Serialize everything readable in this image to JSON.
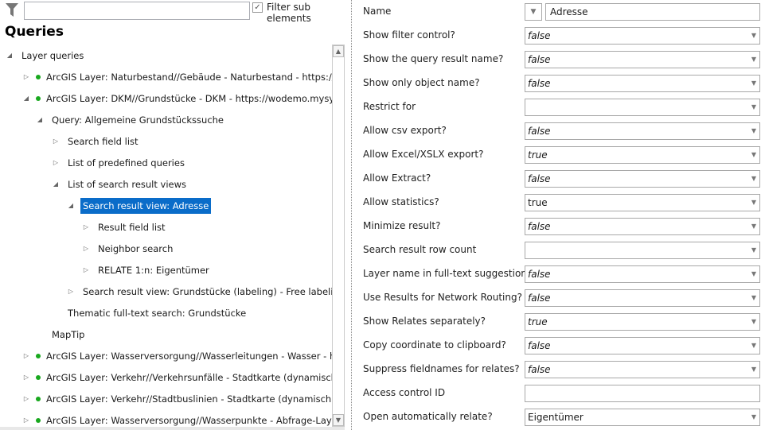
{
  "filter": {
    "placeholder": "",
    "checkbox_label": "Filter sub elements",
    "checked": true
  },
  "title": "Queries",
  "tree": [
    {
      "level": 0,
      "label": "Layer queries",
      "arrow": "expanded",
      "dot": false
    },
    {
      "level": 1,
      "label": "ArcGIS Layer: Naturbestand//Gebäude - Naturbestand - https://wodemo",
      "arrow": "collapsed",
      "dot": true
    },
    {
      "level": 1,
      "label": "ArcGIS Layer: DKM//Grundstücke - DKM - https://wodemo.mysynergis.c",
      "arrow": "expanded",
      "dot": true
    },
    {
      "level": 2,
      "label": "Query: Allgemeine Grundstückssuche",
      "arrow": "expanded",
      "dot": false
    },
    {
      "level": 3,
      "label": "Search field list",
      "arrow": "collapsed",
      "dot": false
    },
    {
      "level": 3,
      "label": "List of predefined queries",
      "arrow": "collapsed",
      "dot": false
    },
    {
      "level": 3,
      "label": "List of search result views",
      "arrow": "expanded",
      "dot": false
    },
    {
      "level": 4,
      "label": "Search result view: Adresse",
      "arrow": "expanded",
      "dot": false,
      "selected": true
    },
    {
      "level": 5,
      "label": "Result field list",
      "arrow": "collapsed",
      "dot": false
    },
    {
      "level": 5,
      "label": "Neighbor search",
      "arrow": "collapsed",
      "dot": false
    },
    {
      "level": 5,
      "label": "RELATE 1:n: Eigentümer",
      "arrow": "collapsed",
      "dot": false
    },
    {
      "level": 4,
      "label": "Search result view: Grundstücke (labeling) - Free labeling",
      "arrow": "collapsed",
      "dot": false
    },
    {
      "level": 3,
      "label": "Thematic full-text search: Grundstücke",
      "arrow": "none",
      "dot": false
    },
    {
      "level": 2,
      "label": "MapTip",
      "arrow": "none",
      "dot": false
    },
    {
      "level": 1,
      "label": "ArcGIS Layer: Wasserversorgung//Wasserleitungen - Wasser - https://w",
      "arrow": "collapsed",
      "dot": true
    },
    {
      "level": 1,
      "label": "ArcGIS Layer: Verkehr//Verkehrsunfälle - Stadtkarte (dynamisch) - https:",
      "arrow": "collapsed",
      "dot": true
    },
    {
      "level": 1,
      "label": "ArcGIS Layer: Verkehr//Stadtbuslinien - Stadtkarte (dynamisch) - https:/",
      "arrow": "collapsed",
      "dot": true
    },
    {
      "level": 1,
      "label": "ArcGIS Layer: Wasserversorgung//Wasserpunkte - Abfrage-Layer für Ar",
      "arrow": "collapsed",
      "dot": true
    }
  ],
  "name": {
    "label": "Name",
    "value": "Adresse"
  },
  "properties": [
    {
      "label": "Show filter control?",
      "value": "false",
      "default": true,
      "type": "select"
    },
    {
      "label": "Show the query result name?",
      "value": "false",
      "default": true,
      "type": "select"
    },
    {
      "label": "Show only object name?",
      "value": "false",
      "default": true,
      "type": "select"
    },
    {
      "label": "Restrict for",
      "value": "",
      "default": false,
      "type": "select"
    },
    {
      "label": "Allow csv export?",
      "value": "false",
      "default": true,
      "type": "select"
    },
    {
      "label": "Allow Excel/XSLX export?",
      "value": "true",
      "default": true,
      "type": "select"
    },
    {
      "label": "Allow Extract?",
      "value": "false",
      "default": true,
      "type": "select"
    },
    {
      "label": "Allow statistics?",
      "value": "true",
      "default": false,
      "type": "select"
    },
    {
      "label": "Minimize result?",
      "value": "false",
      "default": true,
      "type": "select"
    },
    {
      "label": "Search result row count",
      "value": "",
      "default": false,
      "type": "select"
    },
    {
      "label": "Layer name in full-text suggestion?",
      "value": "false",
      "default": true,
      "type": "select"
    },
    {
      "label": "Use Results for Network Routing?",
      "value": "false",
      "default": true,
      "type": "select"
    },
    {
      "label": "Show Relates separately?",
      "value": "true",
      "default": true,
      "type": "select"
    },
    {
      "label": "Copy coordinate to clipboard?",
      "value": "false",
      "default": true,
      "type": "select"
    },
    {
      "label": "Suppress fieldnames for relates?",
      "value": "false",
      "default": true,
      "type": "select"
    },
    {
      "label": "Access control ID",
      "value": "",
      "default": false,
      "type": "text"
    },
    {
      "label": "Open automatically relate?",
      "value": "Eigentümer",
      "default": false,
      "type": "select"
    }
  ]
}
